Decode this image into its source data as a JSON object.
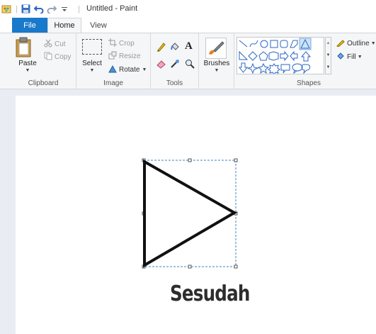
{
  "window": {
    "title": "Untitled - Paint"
  },
  "tabs": [
    {
      "label": "File"
    },
    {
      "label": "Home"
    },
    {
      "label": "View"
    }
  ],
  "ribbon": {
    "clipboard": {
      "paste": "Paste",
      "cut": "Cut",
      "copy": "Copy",
      "group": "Clipboard"
    },
    "image": {
      "select": "Select",
      "crop": "Crop",
      "resize": "Resize",
      "rotate": "Rotate",
      "group": "Image"
    },
    "tools": {
      "group": "Tools"
    },
    "brushes": {
      "label": "Brushes"
    },
    "shapes": {
      "outline": "Outline",
      "fill": "Fill",
      "group": "Shapes"
    }
  },
  "canvas": {
    "caption": "Sesudah"
  },
  "colors": {
    "file_tab": "#1979ca",
    "selection": "#3d86c6"
  }
}
